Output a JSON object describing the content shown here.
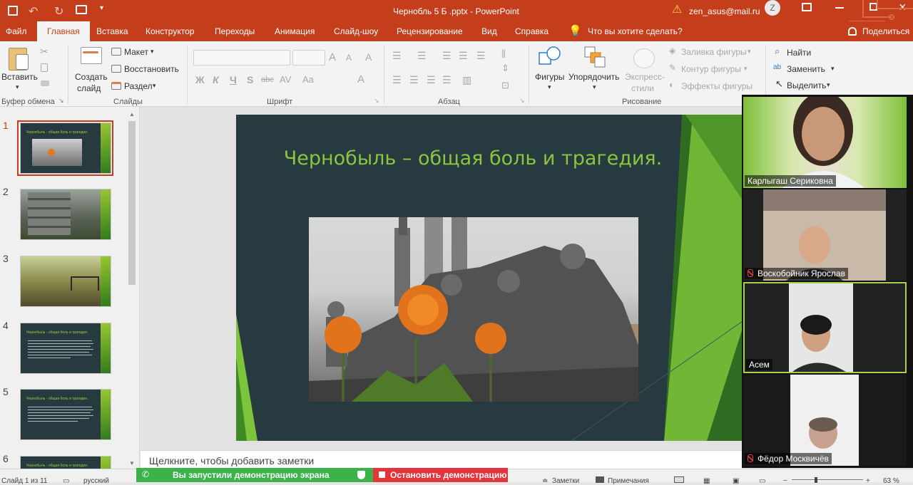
{
  "window": {
    "title": "Чернобль 5 Б .pptx  -  PowerPoint",
    "account": "zen_asus@mail.ru",
    "avatar_initial": "Z"
  },
  "tabs": [
    "Файл",
    "Главная",
    "Вставка",
    "Конструктор",
    "Переходы",
    "Анимация",
    "Слайд-шоу",
    "Рецензирование",
    "Вид",
    "Справка"
  ],
  "tell_me": "Что вы хотите сделать?",
  "share_label": "Поделиться",
  "ribbon": {
    "clipboard": {
      "paste": "Вставить",
      "group": "Буфер обмена"
    },
    "slides": {
      "new_slide": "Создать",
      "new_slide2": "слайд",
      "layout": "Макет",
      "reset": "Восстановить",
      "section": "Раздел",
      "group": "Слайды"
    },
    "font": {
      "bold": "Ж",
      "italic": "К",
      "underline": "Ч",
      "shadow": "S",
      "strike": "abc",
      "group": "Шрифт"
    },
    "paragraph": {
      "group": "Абзац"
    },
    "drawing": {
      "shapes": "Фигуры",
      "arrange": "Упорядочить",
      "quick_styles": "Экспресс-",
      "quick_styles2": "стили",
      "fill": "Заливка фигуры",
      "outline": "Контур фигуры",
      "effects": "Эффекты фигуры",
      "group": "Рисование"
    },
    "editing": {
      "find": "Найти",
      "replace": "Заменить",
      "select": "Выделить"
    }
  },
  "slides_panel": {
    "numbers": [
      "1",
      "2",
      "3",
      "4",
      "5",
      "6"
    ],
    "thumb_title": "Чернобыль - общая боль и трагедия."
  },
  "slide": {
    "title": "Чернобыль – общая боль и трагедия."
  },
  "notes_placeholder": "Щелкните, чтобы добавить заметки",
  "statusbar": {
    "slide_info": "Слайд 1 из 11",
    "language": "русский",
    "notes": "Заметки",
    "comments": "Примечания",
    "zoom": "63 %"
  },
  "screen_share": {
    "status": "Вы запустили демонстрацию экрана",
    "stop": "Остановить демонстрацию"
  },
  "participants": [
    {
      "name": "Карлыгаш Сериковна",
      "muted": false
    },
    {
      "name": "Воскобойник Ярослав",
      "muted": true
    },
    {
      "name": "Асем",
      "muted": false
    },
    {
      "name": "Фёдор Москвичёв",
      "muted": true
    }
  ],
  "colors": {
    "accent": "#c43e1c",
    "slide_bg": "#273a40",
    "title_green": "#8cc63f",
    "share_green": "#3bb34a",
    "share_red": "#e3353b"
  }
}
